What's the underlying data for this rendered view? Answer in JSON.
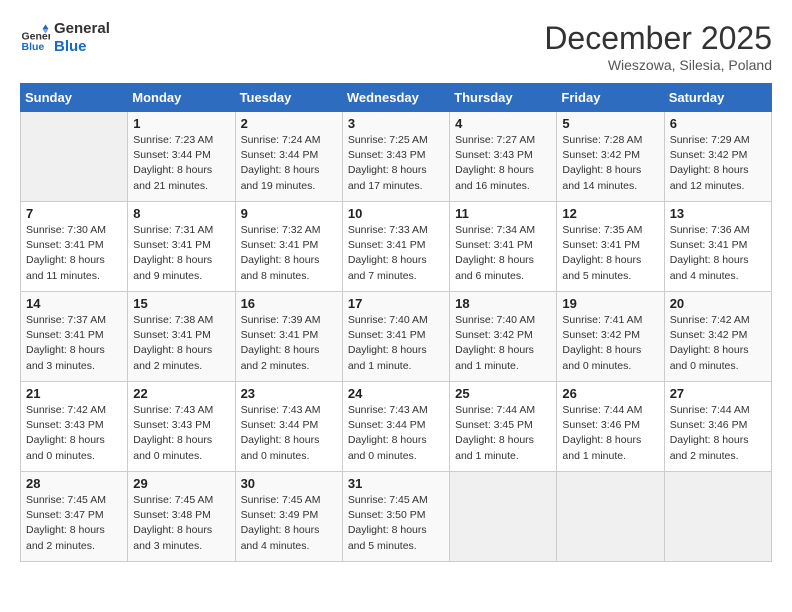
{
  "header": {
    "logo_line1": "General",
    "logo_line2": "Blue",
    "month": "December 2025",
    "location": "Wieszowa, Silesia, Poland"
  },
  "weekdays": [
    "Sunday",
    "Monday",
    "Tuesday",
    "Wednesday",
    "Thursday",
    "Friday",
    "Saturday"
  ],
  "weeks": [
    [
      {
        "day": "",
        "info": ""
      },
      {
        "day": "1",
        "info": "Sunrise: 7:23 AM\nSunset: 3:44 PM\nDaylight: 8 hours\nand 21 minutes."
      },
      {
        "day": "2",
        "info": "Sunrise: 7:24 AM\nSunset: 3:44 PM\nDaylight: 8 hours\nand 19 minutes."
      },
      {
        "day": "3",
        "info": "Sunrise: 7:25 AM\nSunset: 3:43 PM\nDaylight: 8 hours\nand 17 minutes."
      },
      {
        "day": "4",
        "info": "Sunrise: 7:27 AM\nSunset: 3:43 PM\nDaylight: 8 hours\nand 16 minutes."
      },
      {
        "day": "5",
        "info": "Sunrise: 7:28 AM\nSunset: 3:42 PM\nDaylight: 8 hours\nand 14 minutes."
      },
      {
        "day": "6",
        "info": "Sunrise: 7:29 AM\nSunset: 3:42 PM\nDaylight: 8 hours\nand 12 minutes."
      }
    ],
    [
      {
        "day": "7",
        "info": "Sunrise: 7:30 AM\nSunset: 3:41 PM\nDaylight: 8 hours\nand 11 minutes."
      },
      {
        "day": "8",
        "info": "Sunrise: 7:31 AM\nSunset: 3:41 PM\nDaylight: 8 hours\nand 9 minutes."
      },
      {
        "day": "9",
        "info": "Sunrise: 7:32 AM\nSunset: 3:41 PM\nDaylight: 8 hours\nand 8 minutes."
      },
      {
        "day": "10",
        "info": "Sunrise: 7:33 AM\nSunset: 3:41 PM\nDaylight: 8 hours\nand 7 minutes."
      },
      {
        "day": "11",
        "info": "Sunrise: 7:34 AM\nSunset: 3:41 PM\nDaylight: 8 hours\nand 6 minutes."
      },
      {
        "day": "12",
        "info": "Sunrise: 7:35 AM\nSunset: 3:41 PM\nDaylight: 8 hours\nand 5 minutes."
      },
      {
        "day": "13",
        "info": "Sunrise: 7:36 AM\nSunset: 3:41 PM\nDaylight: 8 hours\nand 4 minutes."
      }
    ],
    [
      {
        "day": "14",
        "info": "Sunrise: 7:37 AM\nSunset: 3:41 PM\nDaylight: 8 hours\nand 3 minutes."
      },
      {
        "day": "15",
        "info": "Sunrise: 7:38 AM\nSunset: 3:41 PM\nDaylight: 8 hours\nand 2 minutes."
      },
      {
        "day": "16",
        "info": "Sunrise: 7:39 AM\nSunset: 3:41 PM\nDaylight: 8 hours\nand 2 minutes."
      },
      {
        "day": "17",
        "info": "Sunrise: 7:40 AM\nSunset: 3:41 PM\nDaylight: 8 hours\nand 1 minute."
      },
      {
        "day": "18",
        "info": "Sunrise: 7:40 AM\nSunset: 3:42 PM\nDaylight: 8 hours\nand 1 minute."
      },
      {
        "day": "19",
        "info": "Sunrise: 7:41 AM\nSunset: 3:42 PM\nDaylight: 8 hours\nand 0 minutes."
      },
      {
        "day": "20",
        "info": "Sunrise: 7:42 AM\nSunset: 3:42 PM\nDaylight: 8 hours\nand 0 minutes."
      }
    ],
    [
      {
        "day": "21",
        "info": "Sunrise: 7:42 AM\nSunset: 3:43 PM\nDaylight: 8 hours\nand 0 minutes."
      },
      {
        "day": "22",
        "info": "Sunrise: 7:43 AM\nSunset: 3:43 PM\nDaylight: 8 hours\nand 0 minutes."
      },
      {
        "day": "23",
        "info": "Sunrise: 7:43 AM\nSunset: 3:44 PM\nDaylight: 8 hours\nand 0 minutes."
      },
      {
        "day": "24",
        "info": "Sunrise: 7:43 AM\nSunset: 3:44 PM\nDaylight: 8 hours\nand 0 minutes."
      },
      {
        "day": "25",
        "info": "Sunrise: 7:44 AM\nSunset: 3:45 PM\nDaylight: 8 hours\nand 1 minute."
      },
      {
        "day": "26",
        "info": "Sunrise: 7:44 AM\nSunset: 3:46 PM\nDaylight: 8 hours\nand 1 minute."
      },
      {
        "day": "27",
        "info": "Sunrise: 7:44 AM\nSunset: 3:46 PM\nDaylight: 8 hours\nand 2 minutes."
      }
    ],
    [
      {
        "day": "28",
        "info": "Sunrise: 7:45 AM\nSunset: 3:47 PM\nDaylight: 8 hours\nand 2 minutes."
      },
      {
        "day": "29",
        "info": "Sunrise: 7:45 AM\nSunset: 3:48 PM\nDaylight: 8 hours\nand 3 minutes."
      },
      {
        "day": "30",
        "info": "Sunrise: 7:45 AM\nSunset: 3:49 PM\nDaylight: 8 hours\nand 4 minutes."
      },
      {
        "day": "31",
        "info": "Sunrise: 7:45 AM\nSunset: 3:50 PM\nDaylight: 8 hours\nand 5 minutes."
      },
      {
        "day": "",
        "info": ""
      },
      {
        "day": "",
        "info": ""
      },
      {
        "day": "",
        "info": ""
      }
    ]
  ]
}
